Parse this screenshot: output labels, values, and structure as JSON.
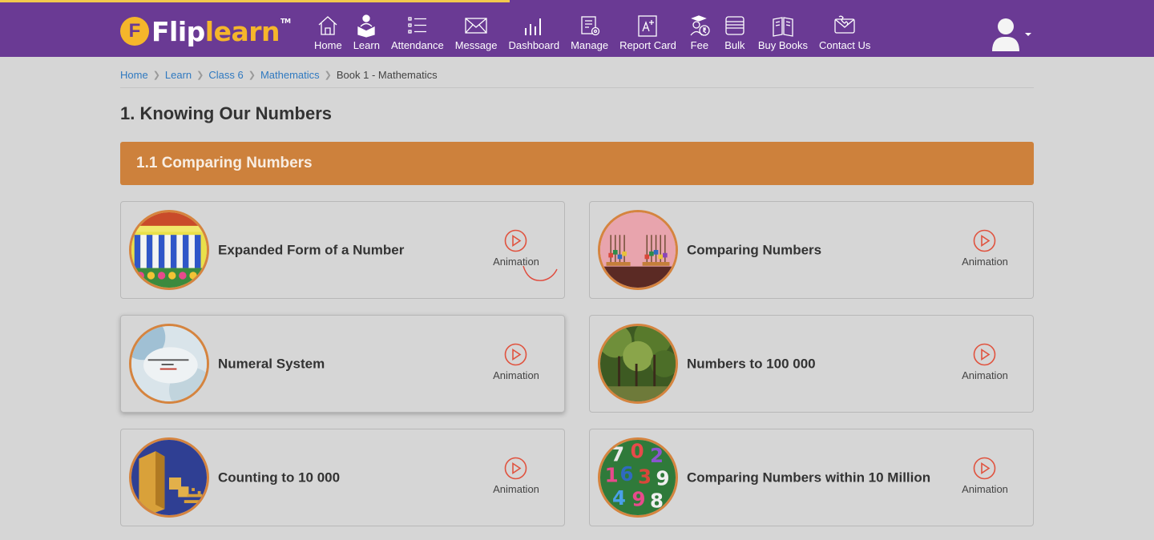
{
  "header": {
    "logo": {
      "initial": "F",
      "flip": "Flip",
      "learn": "learn",
      "tm": "TM"
    },
    "nav": [
      {
        "label": "Home",
        "icon": "home-icon"
      },
      {
        "label": "Learn",
        "icon": "learn-icon"
      },
      {
        "label": "Attendance",
        "icon": "attendance-icon"
      },
      {
        "label": "Message",
        "icon": "message-icon"
      },
      {
        "label": "Dashboard",
        "icon": "dashboard-icon"
      },
      {
        "label": "Manage",
        "icon": "manage-icon"
      },
      {
        "label": "Report Card",
        "icon": "report-card-icon"
      },
      {
        "label": "Fee",
        "icon": "fee-icon"
      },
      {
        "label": "Bulk",
        "icon": "bulk-icon"
      },
      {
        "label": "Buy Books",
        "icon": "buy-books-icon"
      },
      {
        "label": "Contact Us",
        "icon": "contact-us-icon"
      }
    ],
    "avatar_icon": "user-avatar-icon"
  },
  "breadcrumb": {
    "links": [
      "Home",
      "Learn",
      "Class 6",
      "Mathematics"
    ],
    "current": "Book 1 - Mathematics"
  },
  "chapter_title": "1. Knowing Our Numbers",
  "section_title": "1.1 Comparing Numbers",
  "cards": [
    {
      "title": "Expanded Form of a Number",
      "type_label": "Animation",
      "thumbnail": "expanded-form-thumbnail"
    },
    {
      "title": "Comparing Numbers",
      "type_label": "Animation",
      "thumbnail": "comparing-numbers-thumbnail"
    },
    {
      "title": "Numeral System",
      "type_label": "Animation",
      "thumbnail": "numeral-system-thumbnail"
    },
    {
      "title": "Numbers to 100 000",
      "type_label": "Animation",
      "thumbnail": "numbers-to-100000-thumbnail"
    },
    {
      "title": "Counting to 10 000",
      "type_label": "Animation",
      "thumbnail": "counting-to-10000-thumbnail"
    },
    {
      "title": "Comparing Numbers within 10 Million",
      "type_label": "Animation",
      "thumbnail": "comparing-numbers-within-10-million-thumbnail"
    }
  ],
  "colors": {
    "nav_bg": "#6a3a94",
    "logo_accent": "#f5b62b",
    "section_bar": "#cd813c",
    "link": "#2f79c0",
    "play_icon": "#e0533f"
  }
}
